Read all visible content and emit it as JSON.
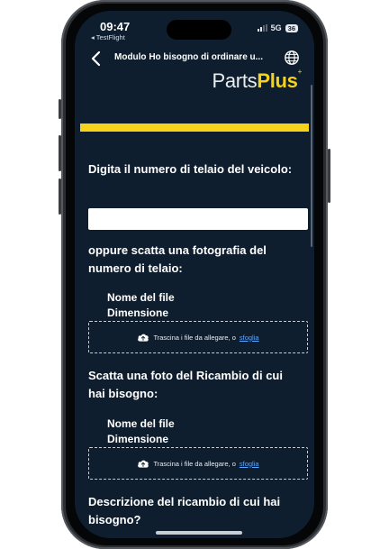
{
  "status_bar": {
    "time": "09:47",
    "back_app": "◂ TestFlight",
    "network": "5G",
    "battery": "36"
  },
  "nav": {
    "title": "Modulo Ho bisogno di ordinare u..."
  },
  "brand": {
    "logo_part1": "Parts",
    "logo_part2": "Plus",
    "logo_mark": "+",
    "accent_color": "#f7d21a",
    "background_color": "#0f1e2e",
    "link_color": "#5aa7ff"
  },
  "form": {
    "vin_label": "Digita il numero di telaio del veicolo:",
    "vin_value": "",
    "vin_photo_label": "oppure scatta una fotografia del numero di telaio:",
    "file1_name_label": "Nome del file",
    "file1_size_label": "Dimensione",
    "dropzone1_text": "Trascina i file da allegare, o",
    "dropzone1_link": "sfoglia",
    "part_photo_label": "Scatta una foto del Ricambio di cui hai bisogno:",
    "file2_name_label": "Nome del file",
    "file2_size_label": "Dimensione",
    "dropzone2_text": "Trascina i file da allegare, o",
    "dropzone2_link": "sfoglia",
    "description_label": "Descrizione del ricambio di cui hai bisogno?"
  },
  "icons": {
    "back": "chevron-left-icon",
    "language": "globe-icon",
    "upload": "cloud-upload-icon"
  }
}
